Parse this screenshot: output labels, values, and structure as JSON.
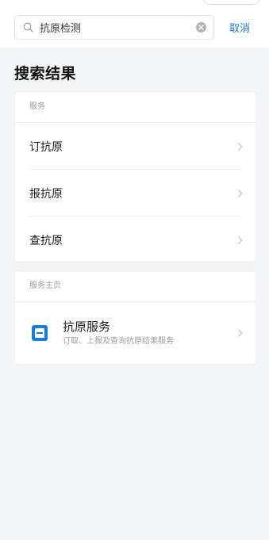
{
  "search": {
    "value": "抗原检测",
    "cancel_label": "取消"
  },
  "page_title": "搜索结果",
  "services_section": {
    "header": "服务",
    "items": [
      {
        "label": "订抗原"
      },
      {
        "label": "报抗原"
      },
      {
        "label": "查抗原"
      }
    ]
  },
  "homepage_section": {
    "header": "服务主页",
    "item": {
      "title": "抗原服务",
      "subtitle": "订取、上报及查询抗原结果服务"
    }
  },
  "colors": {
    "accent": "#1f78d1",
    "icon_blue": "#1a7bd6",
    "background": "#f4f5f7"
  },
  "icons": {
    "search": "search-icon",
    "clear": "clear-icon",
    "chevron": "chevron-right-icon",
    "app": "antigen-service-icon"
  }
}
